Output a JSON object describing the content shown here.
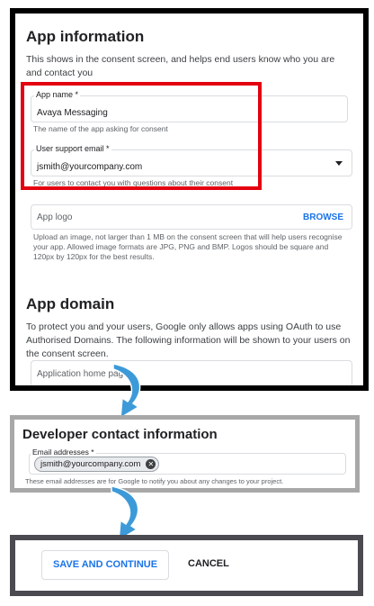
{
  "app_info": {
    "title": "App information",
    "description": "This shows in the consent screen, and helps end users know who you are and contact you",
    "app_name": {
      "label": "App name *",
      "value": "Avaya Messaging",
      "help": "The name of the app asking for consent"
    },
    "support_email": {
      "label": "User support email *",
      "value": "jsmith@yourcompany.com",
      "help": "For users to contact you with questions about their consent"
    },
    "app_logo": {
      "placeholder": "App logo",
      "browse_label": "BROWSE",
      "help": "Upload an image, not larger than 1 MB on the consent screen that will help users recognise your app. Allowed image formats are JPG, PNG and BMP. Logos should be square and 120px by 120px for the best results."
    }
  },
  "app_domain": {
    "title": "App domain",
    "description": "To protect you and your users, Google only allows apps using OAuth to use Authorised Domains. The following information will be shown to your users on the consent screen.",
    "home_page": {
      "placeholder": "Application home page"
    }
  },
  "developer_contact": {
    "title": "Developer contact information",
    "email_label": "Email addresses *",
    "email_chip": "jsmith@yourcompany.com",
    "help": "These email addresses are for Google to notify you about any changes to your project."
  },
  "actions": {
    "save_label": "SAVE AND CONTINUE",
    "cancel_label": "CANCEL"
  },
  "colors": {
    "accent": "#1a73e8",
    "highlight": "#e30010",
    "arrow": "#3d9ad8"
  },
  "icons": {
    "dropdown": "caret-down-icon",
    "chip_remove": "cancel-circle-icon",
    "arrow": "curved-down-arrow-icon"
  }
}
